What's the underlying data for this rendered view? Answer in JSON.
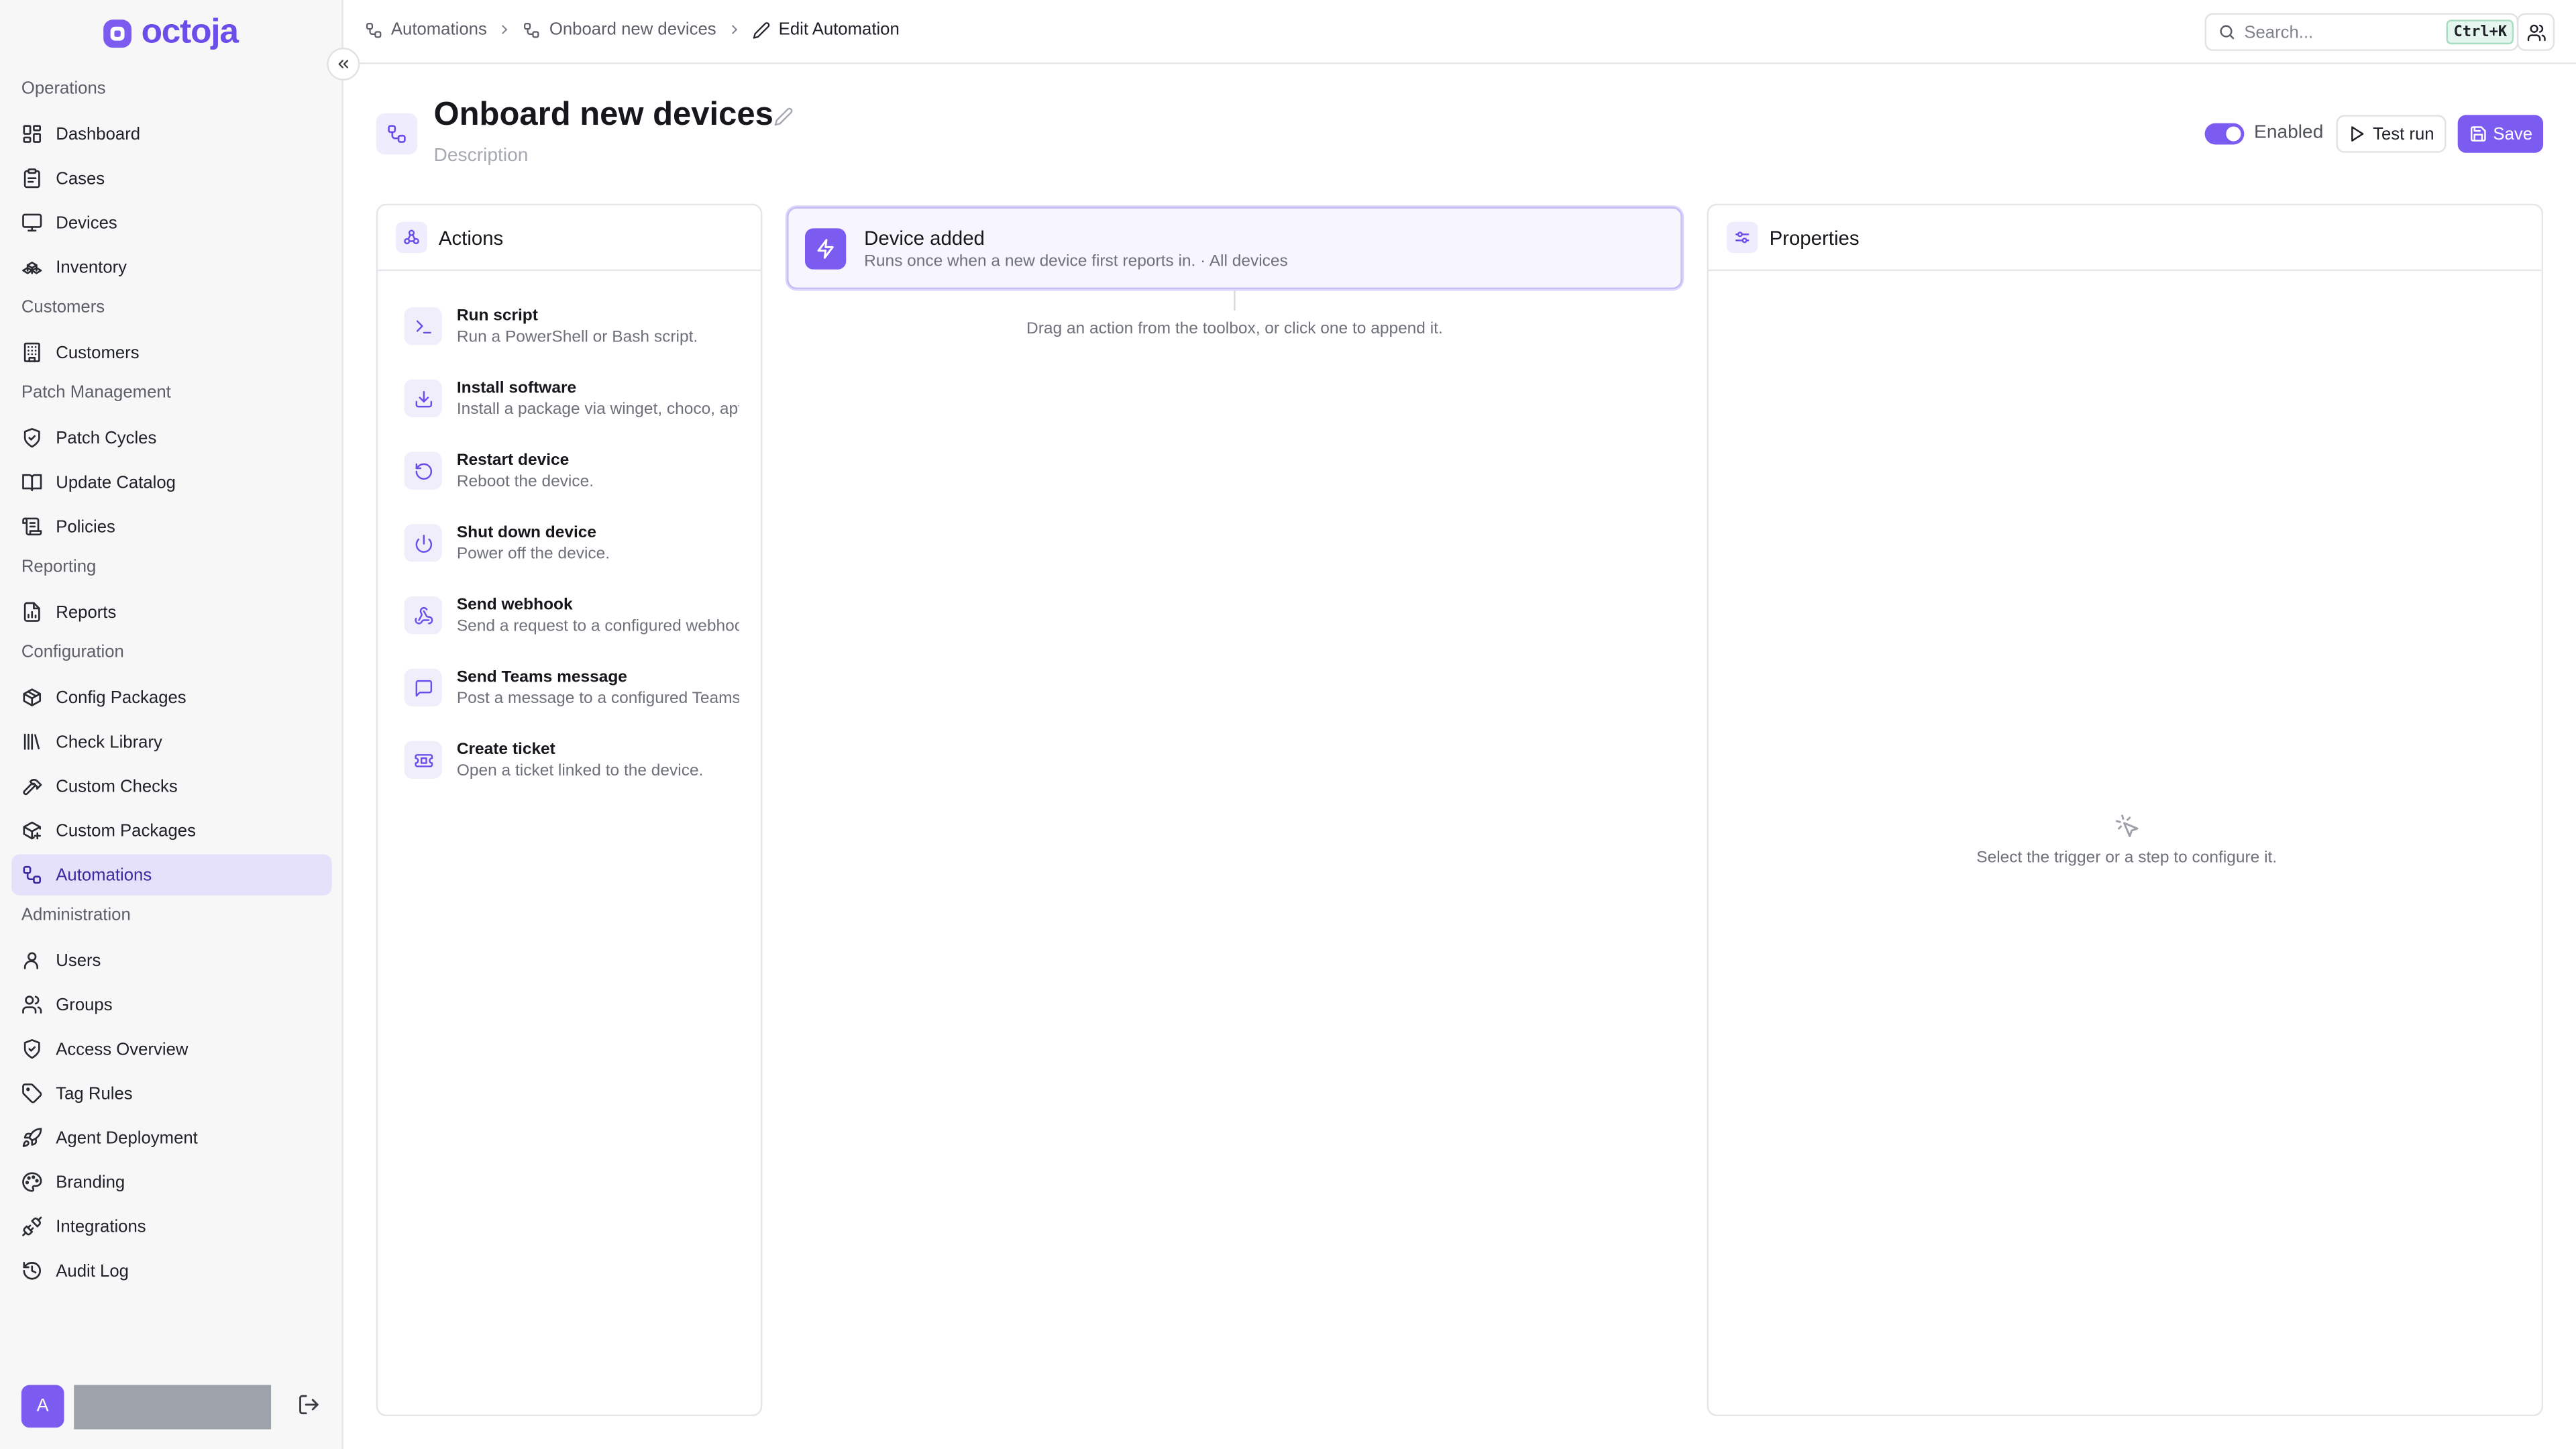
{
  "app": {
    "name": "octoja",
    "accent": "#7c5cf0"
  },
  "sidebar": {
    "sections": [
      {
        "label": "Operations",
        "items": [
          {
            "label": "Dashboard",
            "icon": "dashboard-icon"
          },
          {
            "label": "Cases",
            "icon": "clipboard-icon"
          },
          {
            "label": "Devices",
            "icon": "monitor-icon"
          },
          {
            "label": "Inventory",
            "icon": "boxes-icon"
          }
        ]
      },
      {
        "label": "Customers",
        "items": [
          {
            "label": "Customers",
            "icon": "building-icon"
          }
        ]
      },
      {
        "label": "Patch Management",
        "items": [
          {
            "label": "Patch Cycles",
            "icon": "shield-check-icon"
          },
          {
            "label": "Update Catalog",
            "icon": "book-icon"
          },
          {
            "label": "Policies",
            "icon": "scroll-icon"
          }
        ]
      },
      {
        "label": "Reporting",
        "items": [
          {
            "label": "Reports",
            "icon": "report-icon"
          }
        ]
      },
      {
        "label": "Configuration",
        "items": [
          {
            "label": "Config Packages",
            "icon": "package-icon"
          },
          {
            "label": "Check Library",
            "icon": "library-icon"
          },
          {
            "label": "Custom Checks",
            "icon": "hammer-icon"
          },
          {
            "label": "Custom Packages",
            "icon": "package-plus-icon"
          },
          {
            "label": "Automations",
            "icon": "workflow-icon",
            "active": true
          }
        ]
      },
      {
        "label": "Administration",
        "items": [
          {
            "label": "Users",
            "icon": "user-icon"
          },
          {
            "label": "Groups",
            "icon": "users-icon"
          },
          {
            "label": "Access Overview",
            "icon": "shield-icon"
          },
          {
            "label": "Tag Rules",
            "icon": "tag-icon"
          },
          {
            "label": "Agent Deployment",
            "icon": "rocket-icon"
          },
          {
            "label": "Branding",
            "icon": "palette-icon"
          },
          {
            "label": "Integrations",
            "icon": "plug-icon"
          },
          {
            "label": "Audit Log",
            "icon": "history-icon"
          }
        ]
      }
    ],
    "user_initial": "A"
  },
  "breadcrumb": [
    "Automations",
    "Onboard new devices",
    "Edit Automation"
  ],
  "search": {
    "placeholder": "Search...",
    "shortcut": "Ctrl+K"
  },
  "header": {
    "title": "Onboard new devices",
    "description_placeholder": "Description",
    "enabled_label": "Enabled",
    "enabled": true,
    "test_run_label": "Test run",
    "save_label": "Save"
  },
  "actions_panel": {
    "title": "Actions",
    "items": [
      {
        "title": "Run script",
        "desc": "Run a PowerShell or Bash script.",
        "icon": "terminal-icon"
      },
      {
        "title": "Install software",
        "desc": "Install a package via winget, choco, apt",
        "icon": "download-icon"
      },
      {
        "title": "Restart device",
        "desc": "Reboot the device.",
        "icon": "restart-icon"
      },
      {
        "title": "Shut down device",
        "desc": "Power off the device.",
        "icon": "power-icon"
      },
      {
        "title": "Send webhook",
        "desc": "Send a request to a configured webhook",
        "icon": "webhook-icon"
      },
      {
        "title": "Send Teams message",
        "desc": "Post a message to a configured Teams channel",
        "icon": "message-icon"
      },
      {
        "title": "Create ticket",
        "desc": "Open a ticket linked to the device.",
        "icon": "ticket-icon"
      }
    ]
  },
  "trigger": {
    "title": "Device added",
    "desc": "Runs once when a new device first reports in. · All devices",
    "icon": "zap-icon"
  },
  "canvas": {
    "hint": "Drag an action from the toolbox, or click one to append it."
  },
  "properties_panel": {
    "title": "Properties",
    "empty_text": "Select the trigger or a step to configure it."
  }
}
